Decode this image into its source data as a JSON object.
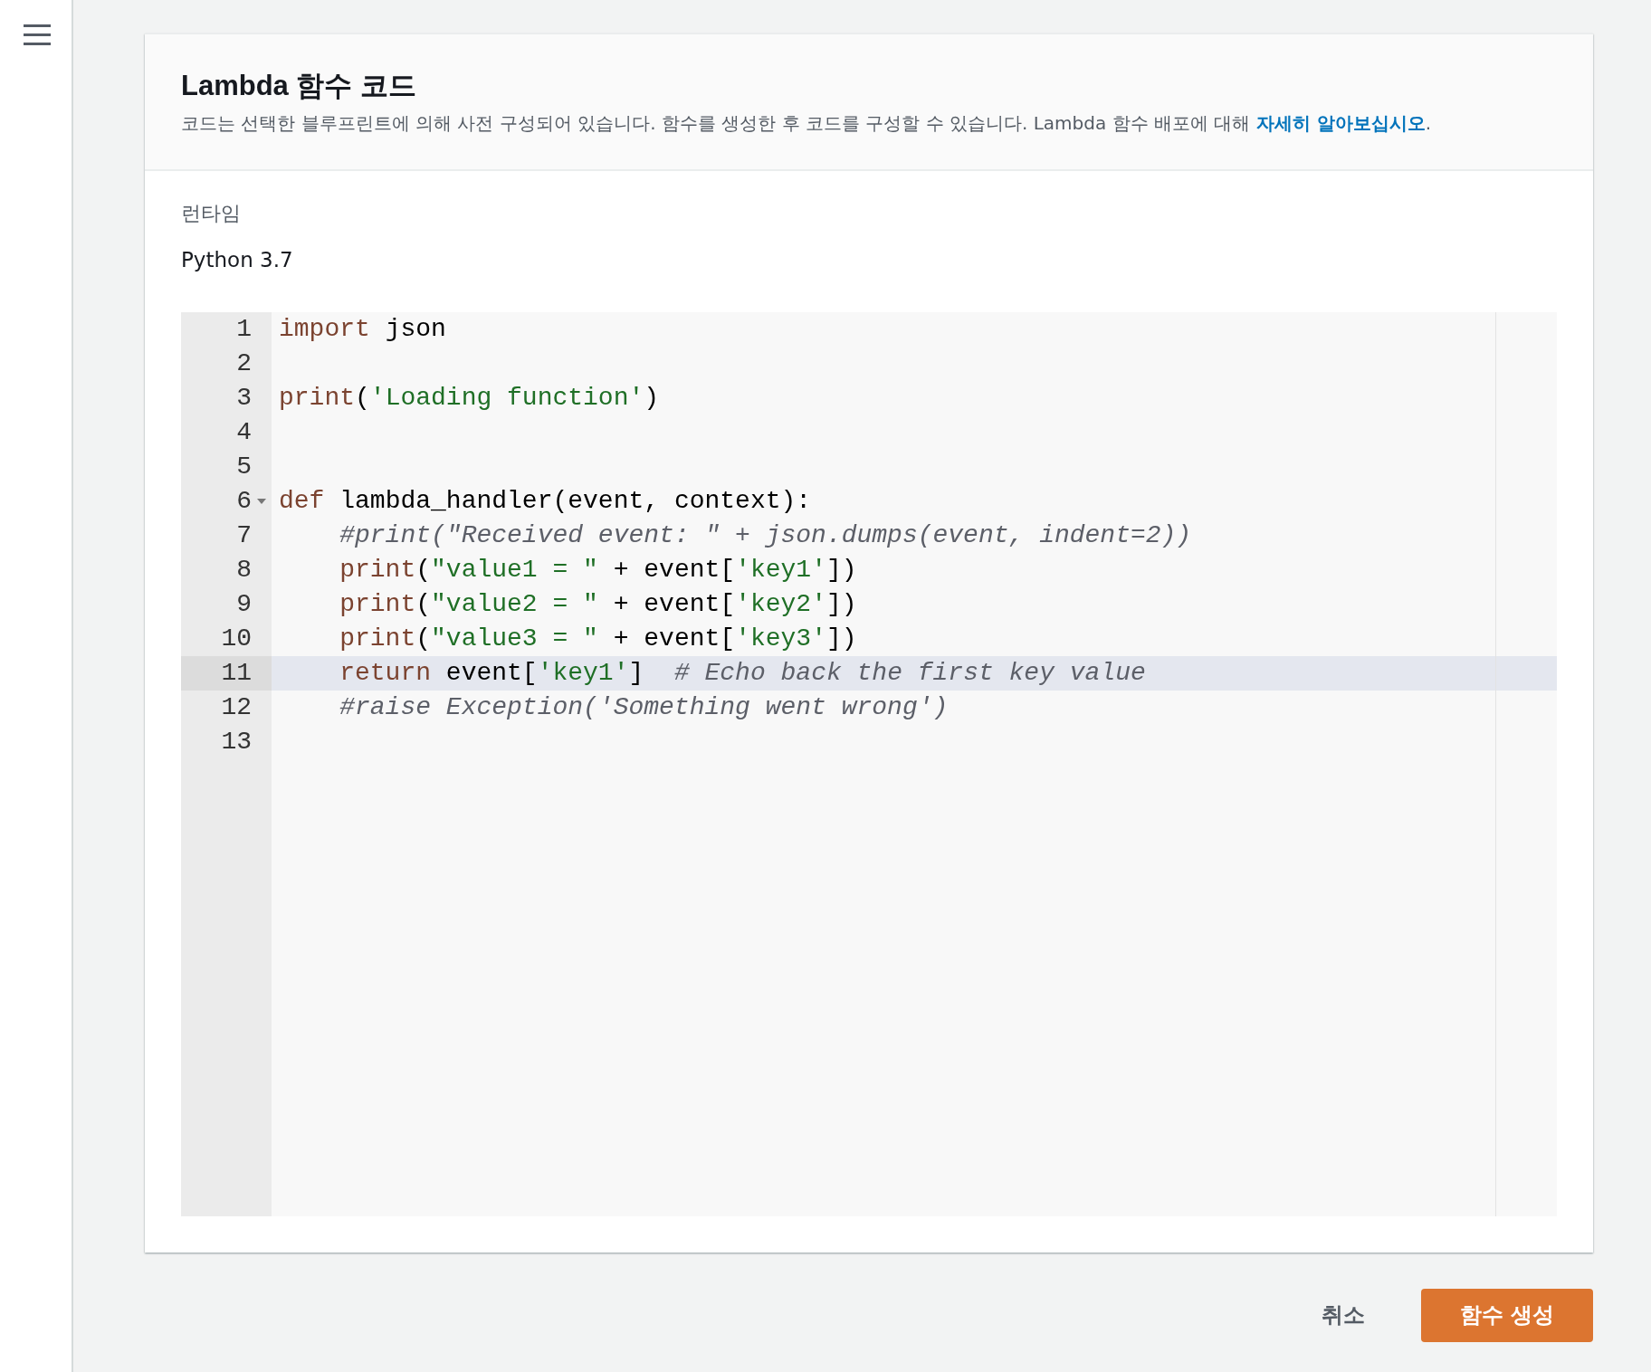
{
  "panel": {
    "title": "Lambda 함수 코드",
    "description": {
      "text": "코드는 선택한 블루프린트에 의해 사전 구성되어 있습니다. 함수를 생성한 후 코드를 구성할 수 있습니다. Lambda 함수 배포에 대해 ",
      "link": "자세히 알아보십시오",
      "after": "."
    }
  },
  "runtime": {
    "label": "런타임",
    "value": "Python 3.7"
  },
  "editor": {
    "lines": [
      {
        "number": "1",
        "selected": false,
        "tokens": [
          {
            "text": "import",
            "kind": "keyword"
          },
          {
            "text": " json",
            "kind": "plain"
          }
        ]
      },
      {
        "number": "2",
        "selected": false
      },
      {
        "number": "3",
        "selected": false,
        "tokens": [
          {
            "text": "print",
            "kind": "keyword"
          },
          {
            "text": "(",
            "kind": "plain"
          },
          {
            "text": "'Loading function'",
            "kind": "string"
          },
          {
            "text": ")",
            "kind": "plain"
          }
        ]
      },
      {
        "number": "4",
        "selected": false
      },
      {
        "number": "5",
        "selected": false
      },
      {
        "number": "6",
        "selected": false,
        "foldable": true,
        "tokens": [
          {
            "text": "def",
            "kind": "keyword"
          },
          {
            "text": " lambda_handler(event, context):",
            "kind": "plain"
          }
        ]
      },
      {
        "number": "7",
        "selected": false,
        "tokens": [
          {
            "text": "    #print(\"Received event: \" + json.dumps(event, indent=2))",
            "kind": "comment"
          }
        ]
      },
      {
        "number": "8",
        "selected": false,
        "tokens": [
          {
            "text": "    print",
            "kind": "keyword"
          },
          {
            "text": "(",
            "kind": "plain"
          },
          {
            "text": "\"value1 = \"",
            "kind": "string"
          },
          {
            "text": " + event[",
            "kind": "plain"
          },
          {
            "text": "'key1'",
            "kind": "string"
          },
          {
            "text": "])",
            "kind": "plain"
          }
        ]
      },
      {
        "number": "9",
        "selected": false,
        "tokens": [
          {
            "text": "    print",
            "kind": "keyword"
          },
          {
            "text": "(",
            "kind": "plain"
          },
          {
            "text": "\"value2 = \"",
            "kind": "string"
          },
          {
            "text": " + event[",
            "kind": "plain"
          },
          {
            "text": "'key2'",
            "kind": "string"
          },
          {
            "text": "])",
            "kind": "plain"
          }
        ]
      },
      {
        "number": "10",
        "selected": false,
        "tokens": [
          {
            "text": "    print",
            "kind": "keyword"
          },
          {
            "text": "(",
            "kind": "plain"
          },
          {
            "text": "\"value3 = \"",
            "kind": "string"
          },
          {
            "text": " + event[",
            "kind": "plain"
          },
          {
            "text": "'key3'",
            "kind": "string"
          },
          {
            "text": "])",
            "kind": "plain"
          }
        ]
      },
      {
        "number": "11",
        "selected": true,
        "tokens": [
          {
            "text": "    return",
            "kind": "keyword"
          },
          {
            "text": " event[",
            "kind": "plain"
          },
          {
            "text": "'key1'",
            "kind": "string"
          },
          {
            "text": "]  ",
            "kind": "plain"
          },
          {
            "text": "# Echo back the first key value",
            "kind": "comment"
          }
        ]
      },
      {
        "number": "12",
        "selected": false,
        "tokens": [
          {
            "text": "    #raise Exception('Something went wrong')",
            "kind": "comment"
          }
        ]
      },
      {
        "number": "13",
        "selected": false
      }
    ]
  },
  "buttons": [
    {
      "label": "취소",
      "kind": "link"
    },
    {
      "label": "함수 생성",
      "kind": "primary"
    }
  ]
}
